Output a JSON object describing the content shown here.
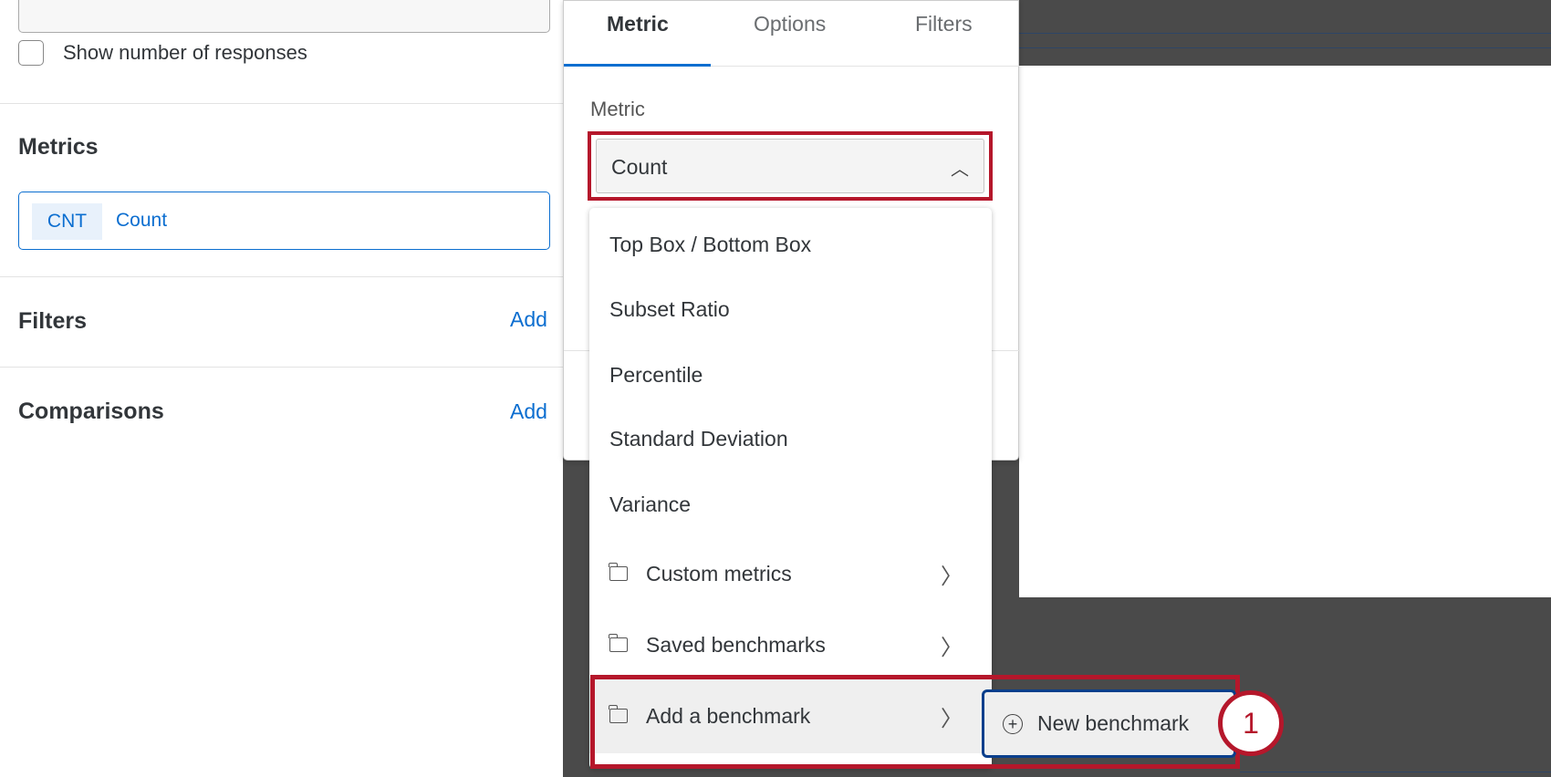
{
  "left_panel": {
    "show_responses_label": "Show number of responses",
    "metrics_heading": "Metrics",
    "metric_chip": {
      "abbr": "CNT",
      "label": "Count"
    },
    "filters_heading": "Filters",
    "filters_add": "Add",
    "comparisons_heading": "Comparisons",
    "comparisons_add": "Add"
  },
  "popover": {
    "tabs": [
      {
        "label": "Metric",
        "active": true
      },
      {
        "label": "Options"
      },
      {
        "label": "Filters"
      }
    ],
    "metric_label": "Metric",
    "metric_select_value": "Count",
    "dropdown_items": [
      {
        "label": "Top Box / Bottom Box"
      },
      {
        "label": "Subset Ratio"
      },
      {
        "label": "Percentile"
      },
      {
        "label": "Standard Deviation"
      },
      {
        "label": "Variance"
      },
      {
        "label": "Custom metrics",
        "icon": "folder-icon",
        "submenu": true
      },
      {
        "label": "Saved benchmarks",
        "icon": "folder-icon",
        "submenu": true
      },
      {
        "label": "Add a benchmark",
        "icon": "folder-icon",
        "submenu": true,
        "highlighted": true
      }
    ],
    "submenu_item": "New benchmark"
  },
  "annotation": {
    "step": "1",
    "color": "#b5172b"
  },
  "colors": {
    "accent": "#0b6ed0",
    "highlight": "#b5172b",
    "background_dark": "#4a4a4a"
  }
}
